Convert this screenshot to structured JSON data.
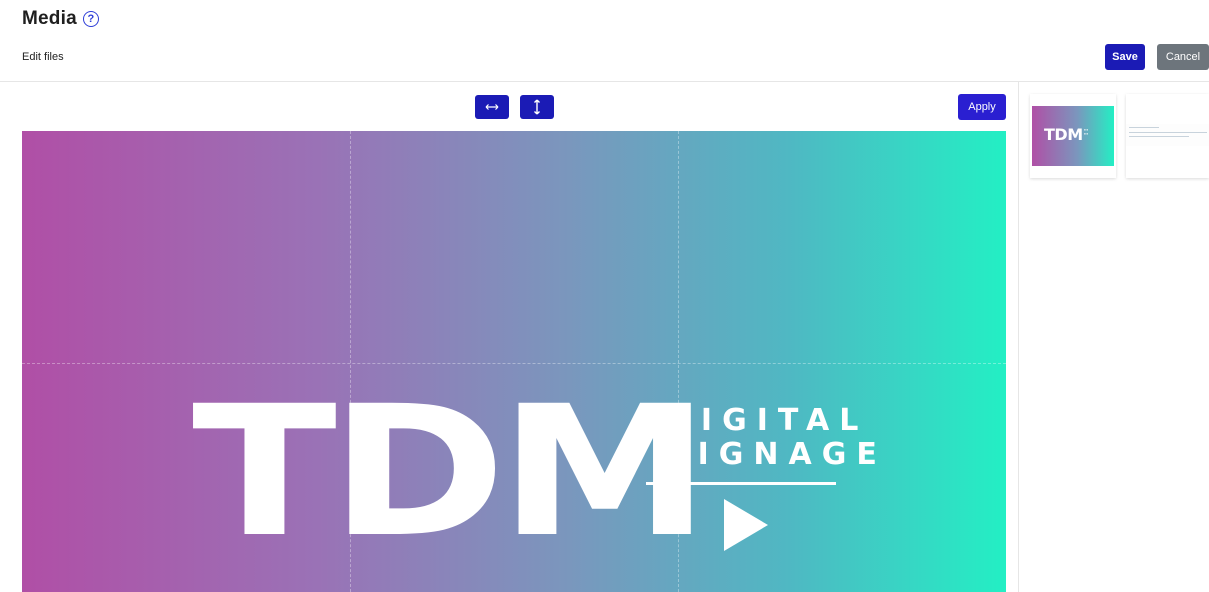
{
  "header": {
    "title": "Media",
    "help_icon": "?",
    "subtitle": "Edit files"
  },
  "toolbar": {
    "save_label": "Save",
    "cancel_label": "Cancel",
    "apply_label": "Apply"
  },
  "editor_tools": [
    {
      "name": "flip-horizontal",
      "icon": "↔"
    },
    {
      "name": "flip-vertical",
      "icon": "↕"
    }
  ],
  "canvas_image": {
    "logo_main": "TDM",
    "logo_line1": "DIGITAL",
    "logo_line2": "SIGNAGE"
  },
  "thumbnails": [
    {
      "label": "TDM"
    },
    {
      "label": ""
    }
  ],
  "colors": {
    "primary": "#1b1bb5",
    "cancel": "#6d757c",
    "gradient_start": "#b04fa6",
    "gradient_end": "#23efc4"
  }
}
